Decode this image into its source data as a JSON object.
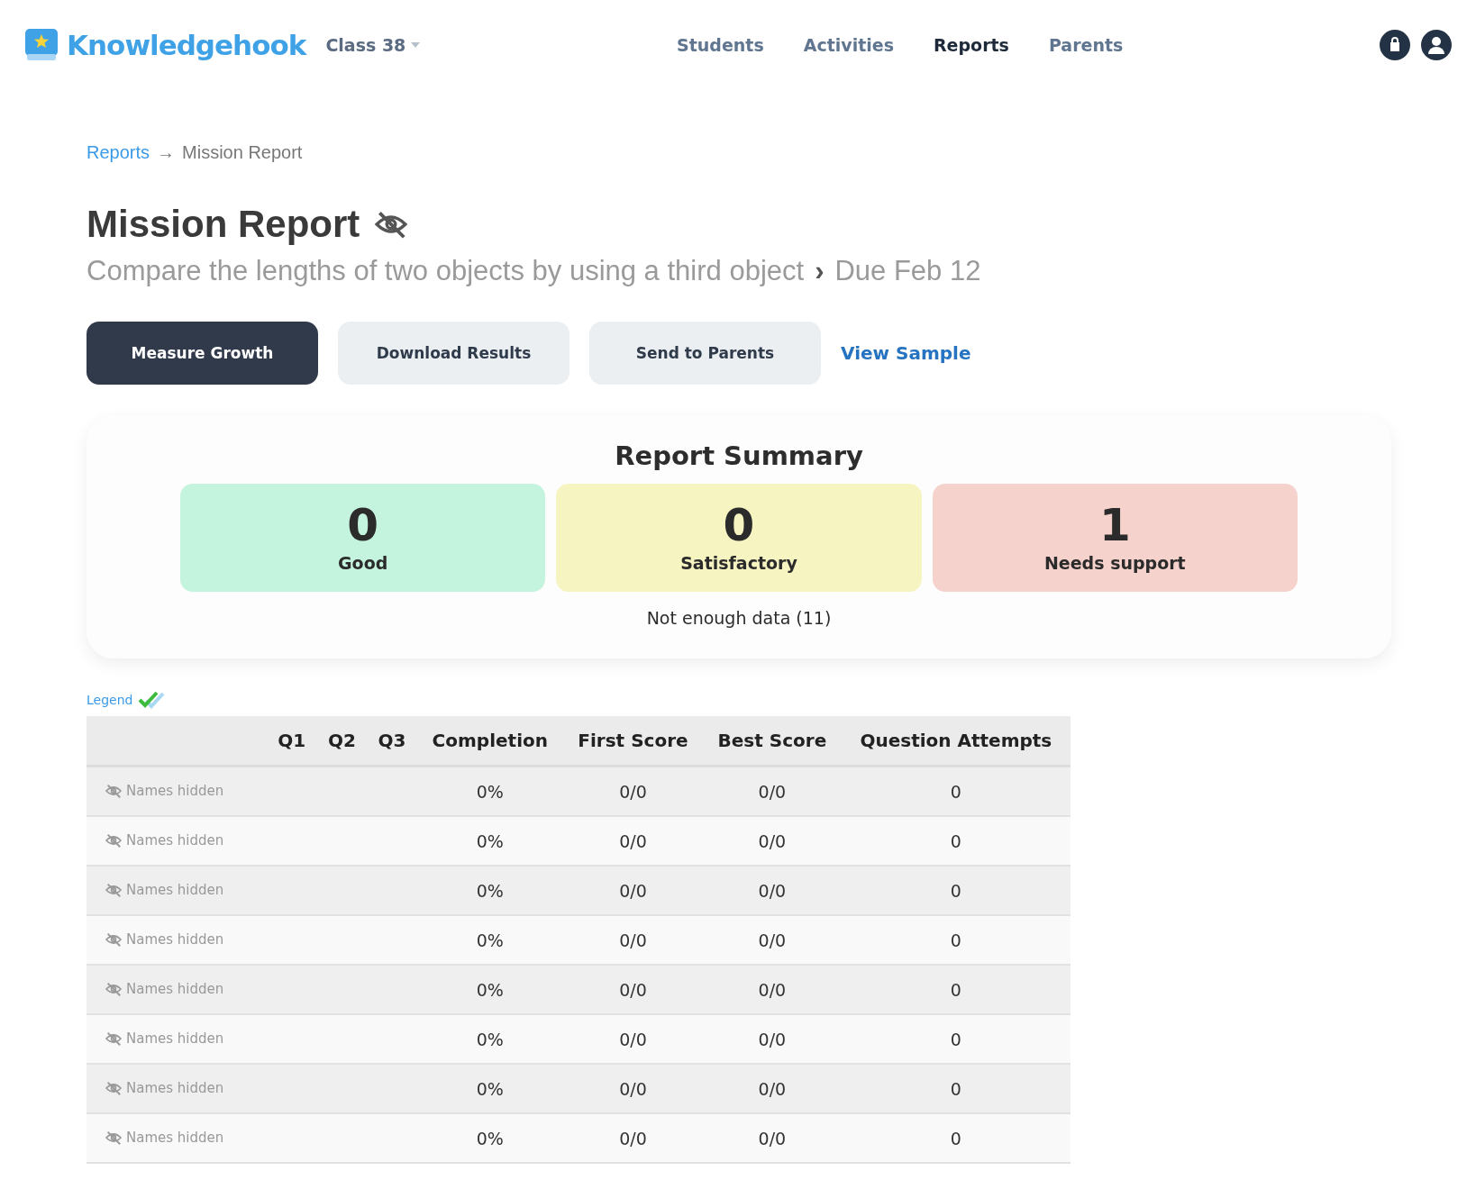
{
  "header": {
    "brand": "Knowledgehook",
    "class_selector": "Class 38",
    "nav": [
      {
        "label": "Students",
        "selected": false
      },
      {
        "label": "Activities",
        "selected": false
      },
      {
        "label": "Reports",
        "selected": true
      },
      {
        "label": "Parents",
        "selected": false
      }
    ]
  },
  "breadcrumb": {
    "link": "Reports",
    "separator": "→",
    "current": "Mission Report"
  },
  "title": "Mission Report",
  "subtitle": {
    "objective": "Compare the lengths of two objects by using a third object",
    "chevron": "›",
    "due": "Due Feb 12"
  },
  "buttons": [
    {
      "label": "Measure Growth",
      "kind": "primary"
    },
    {
      "label": "Download Results",
      "kind": "secondary"
    },
    {
      "label": "Send to Parents",
      "kind": "secondary"
    },
    {
      "label": "View Sample",
      "kind": "link"
    }
  ],
  "summary": {
    "title": "Report Summary",
    "cards": [
      {
        "count": "0",
        "label": "Good",
        "color": "#c5f4de"
      },
      {
        "count": "0",
        "label": "Satisfactory",
        "color": "#f6f4c0"
      },
      {
        "count": "1",
        "label": "Needs support",
        "color": "#f6d2cc"
      }
    ],
    "note": "Not enough data (11)"
  },
  "legend": "Legend",
  "table": {
    "columns": [
      "",
      "Q1",
      "Q2",
      "Q3",
      "Completion",
      "First Score",
      "Best Score",
      "Question Attempts"
    ],
    "rows": [
      {
        "name": "Names hidden",
        "completion": "0%",
        "first_score": "0/0",
        "best_score": "0/0",
        "attempts": "0"
      },
      {
        "name": "Names hidden",
        "completion": "0%",
        "first_score": "0/0",
        "best_score": "0/0",
        "attempts": "0"
      },
      {
        "name": "Names hidden",
        "completion": "0%",
        "first_score": "0/0",
        "best_score": "0/0",
        "attempts": "0"
      },
      {
        "name": "Names hidden",
        "completion": "0%",
        "first_score": "0/0",
        "best_score": "0/0",
        "attempts": "0"
      },
      {
        "name": "Names hidden",
        "completion": "0%",
        "first_score": "0/0",
        "best_score": "0/0",
        "attempts": "0"
      },
      {
        "name": "Names hidden",
        "completion": "0%",
        "first_score": "0/0",
        "best_score": "0/0",
        "attempts": "0"
      },
      {
        "name": "Names hidden",
        "completion": "0%",
        "first_score": "0/0",
        "best_score": "0/0",
        "attempts": "0"
      },
      {
        "name": "Names hidden",
        "completion": "0%",
        "first_score": "0/0",
        "best_score": "0/0",
        "attempts": "0"
      }
    ]
  }
}
